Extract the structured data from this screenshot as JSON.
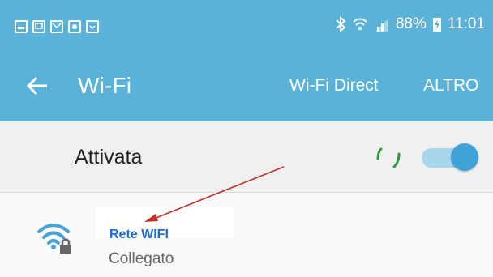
{
  "status_bar": {
    "notification_icons": [
      "gallery-icon",
      "screen-icon",
      "mail-icon",
      "app-icon",
      "download-icon"
    ],
    "bluetooth_icon": "bluetooth-icon",
    "wifi_icon": "wifi-signal-icon",
    "signal_icon": "cell-signal-icon",
    "battery_percent": "88%",
    "battery_icon": "battery-charging-icon",
    "time": "11:01"
  },
  "toolbar": {
    "back_icon": "back-arrow-icon",
    "title": "Wi-Fi",
    "wifi_direct_label": "Wi-Fi Direct",
    "more_label": "ALTRO"
  },
  "wifi_toggle": {
    "label": "Attivata",
    "state": "on",
    "loading_icon": "spinner-icon"
  },
  "networks": [
    {
      "name": "Rete WIFI",
      "status": "Collegato",
      "icon": "wifi-lock-icon"
    }
  ],
  "colors": {
    "header": "#5ab2d8",
    "accent": "#3fa3d8",
    "network_name": "#1e6bd6",
    "annotation_arrow": "#c0312b"
  }
}
